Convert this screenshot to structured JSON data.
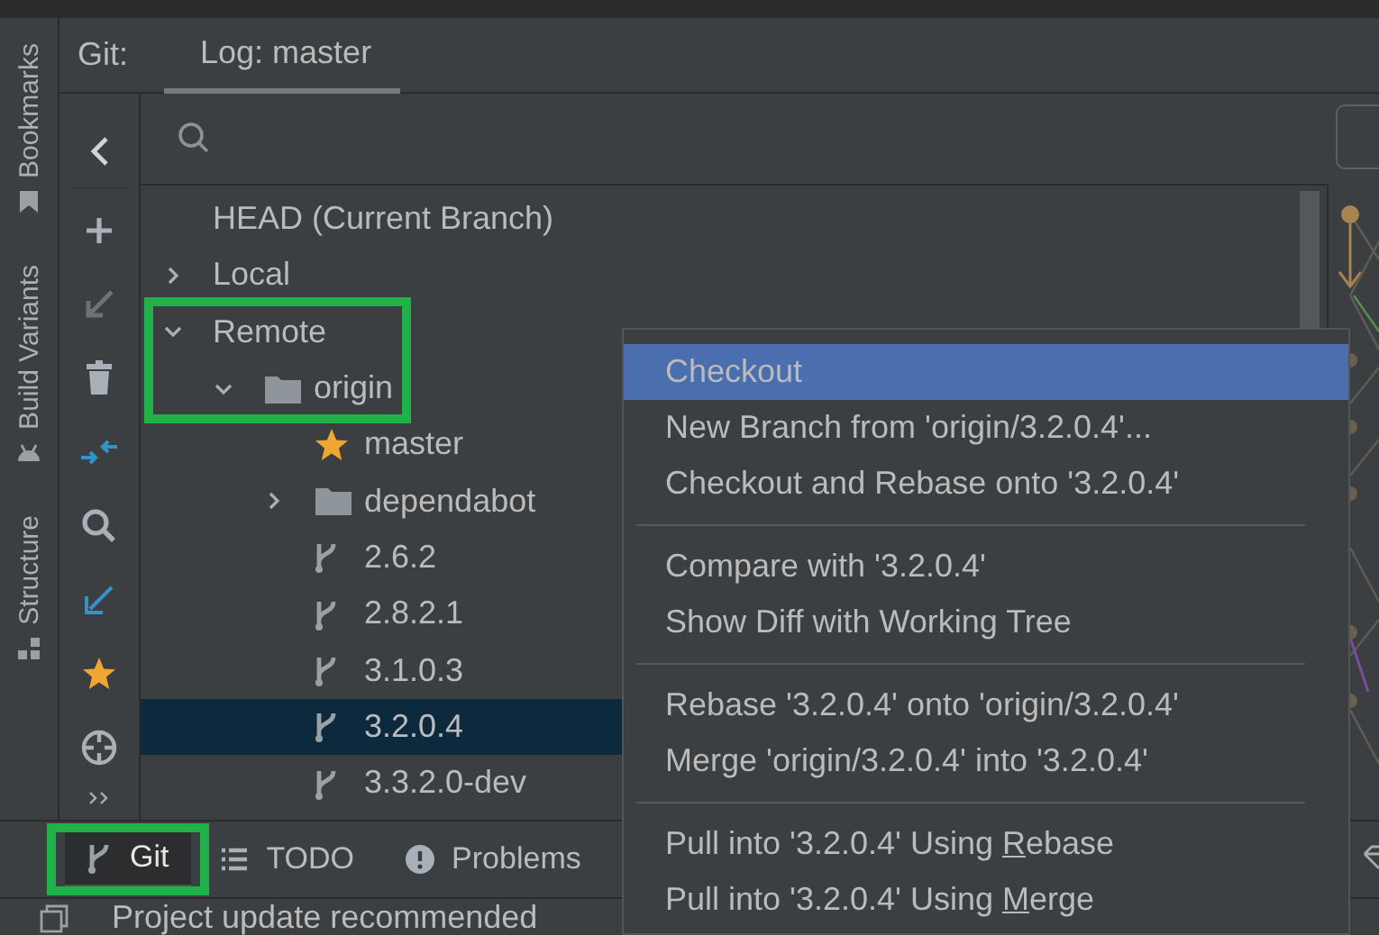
{
  "side_stripe": [
    {
      "label": "Bookmarks"
    },
    {
      "label": "Build Variants"
    },
    {
      "label": "Structure"
    }
  ],
  "tool_window": {
    "title": "Git:",
    "tabs": [
      {
        "label": "Log: master",
        "selected": true
      }
    ]
  },
  "toolbar": [
    {
      "disabled": false
    },
    {
      "disabled": false
    },
    {
      "disabled": true
    },
    {
      "disabled": false
    },
    {
      "disabled": false
    },
    {
      "disabled": false
    },
    {
      "disabled": false
    },
    {
      "disabled": false
    },
    {
      "disabled": false
    },
    {
      "disabled": false
    }
  ],
  "branches": [
    {
      "label": "HEAD (Current Branch)",
      "kind": "head",
      "selected": false,
      "highlighted": false
    },
    {
      "label": "Local",
      "kind": "group",
      "expanded": false,
      "selected": false,
      "highlighted": false
    },
    {
      "label": "Remote",
      "kind": "group",
      "expanded": true,
      "selected": false,
      "highlighted": true,
      "children": [
        {
          "label": "origin",
          "kind": "folder",
          "expanded": true,
          "selected": false,
          "highlighted": true,
          "children": [
            {
              "label": "master",
              "kind": "favorite",
              "selected": false,
              "highlighted": false
            },
            {
              "label": "dependabot",
              "kind": "folder",
              "expanded": false,
              "selected": false,
              "highlighted": false
            },
            {
              "label": "2.6.2",
              "kind": "branch",
              "selected": false,
              "highlighted": false
            },
            {
              "label": "2.8.2.1",
              "kind": "branch",
              "selected": false,
              "highlighted": false
            },
            {
              "label": "3.1.0.3",
              "kind": "branch",
              "selected": false,
              "highlighted": false
            },
            {
              "label": "3.2.0.4",
              "kind": "branch",
              "selected": true,
              "highlighted": false
            },
            {
              "label": "3.3.2.0-dev",
              "kind": "branch",
              "selected": false,
              "highlighted": false
            }
          ]
        }
      ]
    }
  ],
  "context_menu": [
    {
      "kind": "item",
      "label": "Checkout",
      "selected": true
    },
    {
      "kind": "item",
      "label": "New Branch from 'origin/3.2.0.4'...",
      "selected": false
    },
    {
      "kind": "item",
      "label": "Checkout and Rebase onto '3.2.0.4'",
      "selected": false
    },
    {
      "kind": "separator"
    },
    {
      "kind": "item",
      "label": "Compare with '3.2.0.4'",
      "selected": false
    },
    {
      "kind": "item",
      "label": "Show Diff with Working Tree",
      "selected": false
    },
    {
      "kind": "separator"
    },
    {
      "kind": "item",
      "label": "Rebase '3.2.0.4' onto 'origin/3.2.0.4'",
      "selected": false
    },
    {
      "kind": "item",
      "label": "Merge 'origin/3.2.0.4' into '3.2.0.4'",
      "selected": false
    },
    {
      "kind": "separator"
    },
    {
      "kind": "mnemonic",
      "before": "Pull into '3.2.0.4' Using ",
      "mnemonic": "R",
      "after": "ebase",
      "selected": false
    },
    {
      "kind": "mnemonic",
      "before": "Pull into '3.2.0.4' Using ",
      "mnemonic": "M",
      "after": "erge",
      "selected": false
    }
  ],
  "bottom_tabs": [
    {
      "label": "Git",
      "selected": true,
      "highlighted": true
    },
    {
      "label": "TODO",
      "selected": false,
      "highlighted": false
    },
    {
      "label": "Problems",
      "selected": false,
      "highlighted": false
    }
  ],
  "status_bar": {
    "message": "Project update recommended"
  }
}
